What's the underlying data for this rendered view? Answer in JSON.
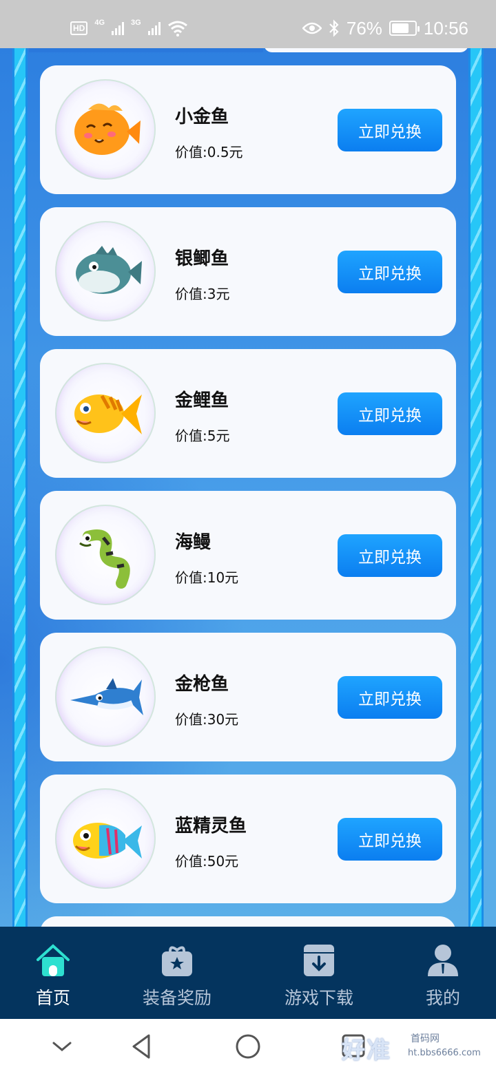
{
  "status_bar": {
    "hd_label": "HD",
    "sim1_net": "4G",
    "sim2_net": "3G",
    "battery_percent": "76%",
    "battery_level": 0.76,
    "time": "10:56",
    "icons": [
      "signal-icon",
      "wifi-icon",
      "eye-icon",
      "bluetooth-icon",
      "battery-icon"
    ]
  },
  "items": [
    {
      "name": "小金鱼",
      "value": "价值:0.5元",
      "button": "立即兑换",
      "fish_color": "#ff9a1a"
    },
    {
      "name": "银鲫鱼",
      "value": "价值:3元",
      "button": "立即兑换",
      "fish_color": "#4c8f96"
    },
    {
      "name": "金鲤鱼",
      "value": "价值:5元",
      "button": "立即兑换",
      "fish_color": "#ffc21a"
    },
    {
      "name": "海鳗",
      "value": "价值:10元",
      "button": "立即兑换",
      "fish_color": "#8cbf3a"
    },
    {
      "name": "金枪鱼",
      "value": "价值:30元",
      "button": "立即兑换",
      "fish_color": "#2f7fd0"
    },
    {
      "name": "蓝精灵鱼",
      "value": "价值:50元",
      "button": "立即兑换",
      "fish_color": "#ffd21a"
    }
  ],
  "bottom_nav": {
    "home": "首页",
    "rewards": "装备奖励",
    "download": "游戏下载",
    "mine": "我的",
    "active": "home"
  },
  "watermark": {
    "text": "好准",
    "sub": "首码网",
    "url": "ht.bbs6666.com"
  },
  "colors": {
    "accent": "#0b7ef0",
    "nav_bg": "#04345e",
    "active_icon": "#2ee0d0"
  }
}
